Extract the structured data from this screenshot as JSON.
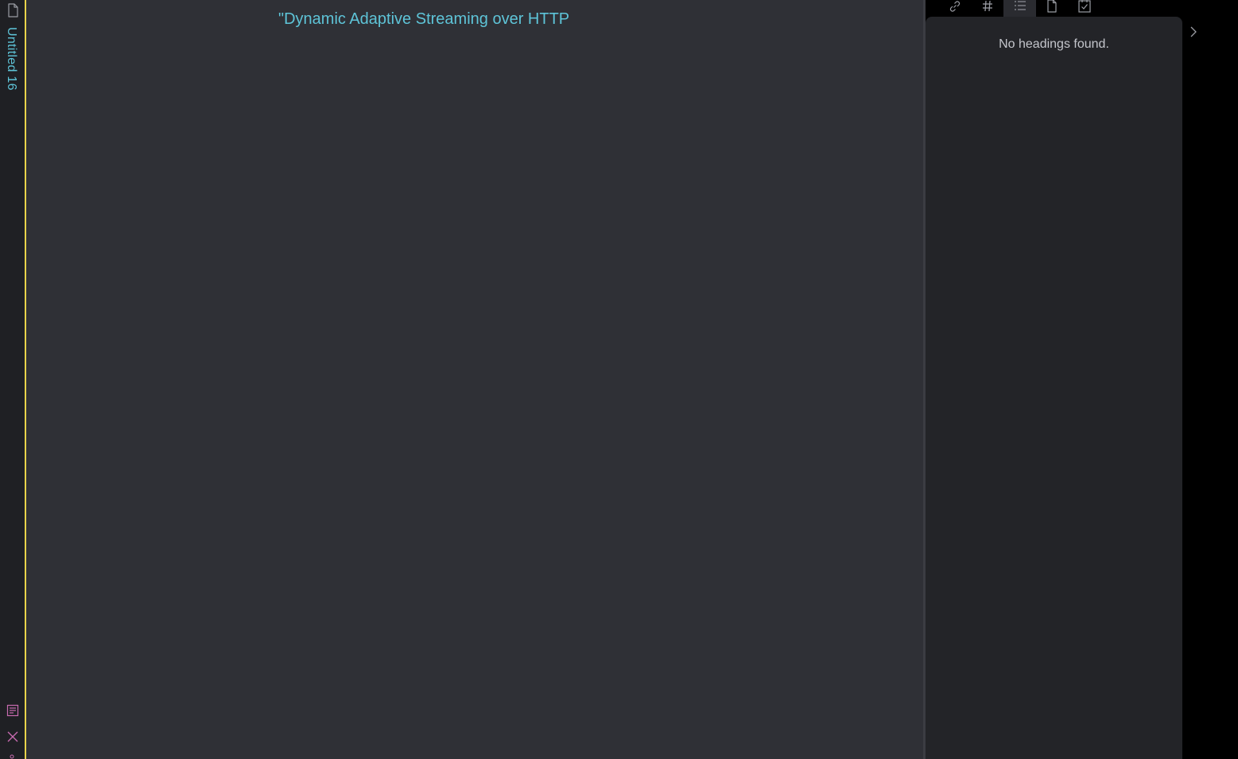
{
  "colors": {
    "accent": "#5ec4d8",
    "active_tab_border": "#e8d34a",
    "editor_bg": "#2f3036",
    "sidebar_bg": "#232428",
    "muted_icon": "#9a9ca3",
    "pink_icon": "#c86bb0"
  },
  "tab_strip": {
    "file_icon": "file-icon",
    "tab_title": "Untitled 16",
    "reading_icon": "reading-view-icon",
    "close_icon": "close-icon"
  },
  "editor": {
    "lines": [
      "\"Dynamic Adaptive Streaming over HTTP"
    ]
  },
  "sidebar": {
    "tabs": [
      {
        "icon": "link-icon"
      },
      {
        "icon": "hash-tag-icon"
      },
      {
        "icon": "list-outline-icon",
        "active": true
      },
      {
        "icon": "file-icon"
      },
      {
        "icon": "calendar-check-icon"
      }
    ],
    "outline": {
      "empty_message": "No headings found."
    }
  },
  "collapse_icon": "chevron-right-icon"
}
